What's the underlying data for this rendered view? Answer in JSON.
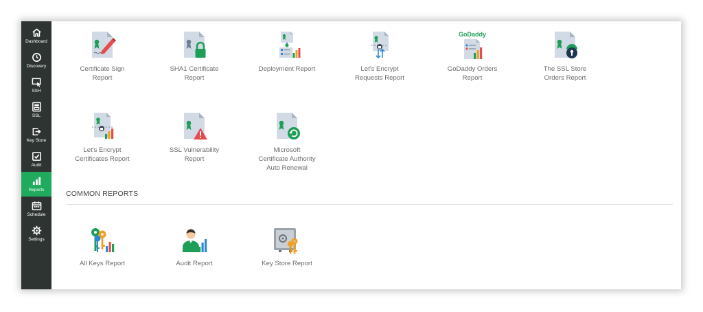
{
  "sidebar": {
    "items": [
      {
        "label": "Dashboard",
        "icon": "home-icon",
        "active": false
      },
      {
        "label": "Discovery",
        "icon": "discovery-icon",
        "active": false
      },
      {
        "label": "SSH",
        "icon": "ssh-icon",
        "active": false
      },
      {
        "label": "SSL",
        "icon": "ssl-icon",
        "active": false
      },
      {
        "label": "Key Store",
        "icon": "key-store-icon",
        "active": false
      },
      {
        "label": "Audit",
        "icon": "audit-icon",
        "active": false
      },
      {
        "label": "Reports",
        "icon": "reports-icon",
        "active": true
      },
      {
        "label": "Schedule",
        "icon": "calendar-icon",
        "active": false
      },
      {
        "label": "Settings",
        "icon": "gear-icon",
        "active": false
      }
    ],
    "accent_color": "#1faa5e",
    "background_color": "#2e3431"
  },
  "ssl_reports": [
    {
      "label": "Certificate Sign\nReport",
      "icon": "certificate-sign-icon"
    },
    {
      "label": "SHA1 Certificate\nReport",
      "icon": "certificate-lock-icon"
    },
    {
      "label": "Deployment Report",
      "icon": "deployment-icon"
    },
    {
      "label": "Let's Encrypt\nRequests Report",
      "icon": "lets-encrypt-requests-icon"
    },
    {
      "label": "GoDaddy Orders\nReport",
      "icon": "godaddy-orders-icon",
      "brand_text": "GoDaddy"
    },
    {
      "label": "The SSL Store\nOrders Report",
      "icon": "ssl-store-orders-icon"
    },
    {
      "label": "Let's Encrypt\nCertificates Report",
      "icon": "lets-encrypt-certificates-icon"
    },
    {
      "label": "SSL Vulnerability\nReport",
      "icon": "certificate-warning-icon"
    },
    {
      "label": "Microsoft\nCertificate Authority\nAuto Renewal",
      "icon": "certificate-renewal-icon"
    }
  ],
  "common_reports": {
    "title": "COMMON REPORTS",
    "items": [
      {
        "label": "All Keys Report",
        "icon": "keys-chart-icon"
      },
      {
        "label": "Audit Report",
        "icon": "user-chart-icon"
      },
      {
        "label": "Key Store Report",
        "icon": "safe-keys-icon"
      }
    ]
  }
}
